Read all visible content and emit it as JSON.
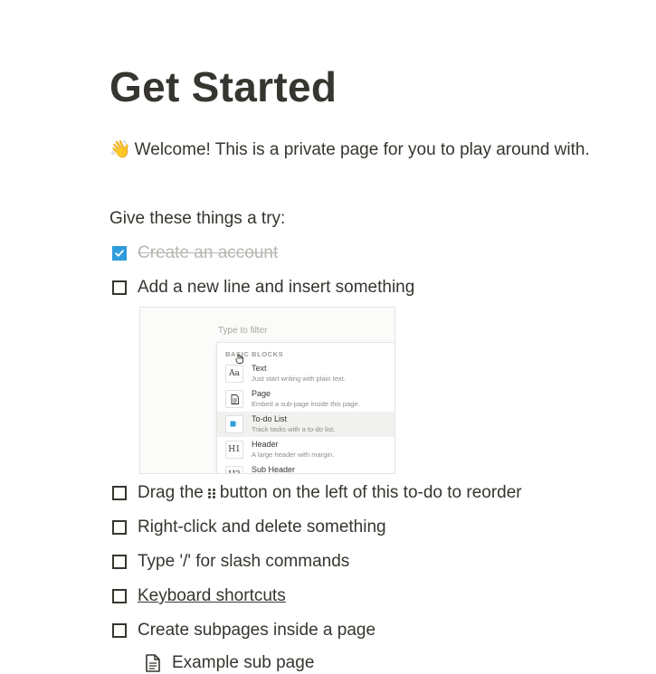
{
  "page": {
    "title": "Get Started",
    "welcome_emoji": "👋",
    "welcome_text": "Welcome! This is a private page for you to play around with.",
    "intro": "Give these things a try:"
  },
  "todos": [
    {
      "label": "Create an account",
      "checked": true
    },
    {
      "label": "Add a new line and insert something",
      "checked": false
    },
    {
      "label_before": "Drag the",
      "label_after": "button on the left of this to-do to reorder",
      "checked": false
    },
    {
      "label": "Right-click and delete something",
      "checked": false
    },
    {
      "label": "Type '/' for slash commands",
      "checked": false
    },
    {
      "label": "Keyboard shortcuts",
      "checked": false,
      "link": true
    },
    {
      "label": "Create subpages inside a page",
      "checked": false
    }
  ],
  "subpage": {
    "label": "Example sub page",
    "icon": "page-icon"
  },
  "embed": {
    "filter_placeholder": "Type to filter",
    "section_header": "BASIC BLOCKS",
    "items": [
      {
        "icon_text": "Aa",
        "title": "Text",
        "desc": "Just start writing with plain text."
      },
      {
        "icon_text": "",
        "title": "Page",
        "desc": "Embed a sub-page inside this page."
      },
      {
        "icon_text": "",
        "title": "To-do List",
        "desc": "Track tasks with a to-do list."
      },
      {
        "icon_text": "H1",
        "title": "Header",
        "desc": "A large header with margin."
      },
      {
        "icon_text": "H2",
        "title": "Sub Header",
        "desc": ""
      }
    ]
  },
  "colors": {
    "text": "#37352f",
    "checkbox_accent": "#2e9cdb",
    "muted": "#b7b6b2"
  }
}
